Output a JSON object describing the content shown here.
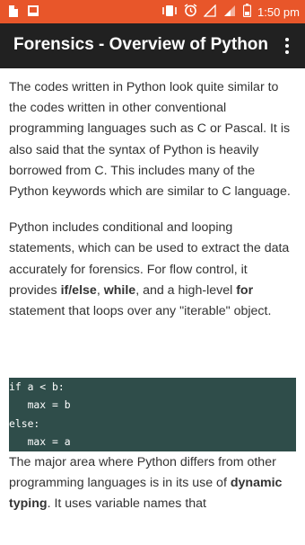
{
  "status_bar": {
    "time": "1:50 pm",
    "left_icons": [
      "file-icon",
      "image-icon"
    ],
    "right_icons": [
      "vibrate-icon",
      "alarm-icon",
      "no-signal-icon",
      "signal-icon",
      "battery-icon"
    ]
  },
  "app_bar": {
    "title": "Forensics - Overview of Python",
    "menu_icon": "more-vertical-icon"
  },
  "content": {
    "para1": "The codes written in Python look quite similar to the codes written in other conventional programming languages such as C or Pascal. It is also said that the syntax of Python is heavily borrowed from C. This includes many of the Python keywords which are similar to C language.",
    "para2": {
      "intro": "Python includes conditional and looping statements, which can be used to extract the data accurately for forensics. For flow control, it provides ",
      "kw_ifelse": "if/else",
      "sep1": ", ",
      "kw_while": "while",
      "mid": ", and a high-level ",
      "kw_for": "for",
      "end": " statement that loops over any \"iterable\" object."
    },
    "code_lines": [
      "if a < b:",
      "   max = b",
      "else:",
      "   max = a"
    ],
    "para3": {
      "intro": "The major area where Python differs from other programming languages is in its use of ",
      "kw_dynamic": "dynamic typing",
      "rest": ". It uses variable names that"
    }
  },
  "colors": {
    "status_bar": "#e8562a",
    "app_bar": "#212121",
    "code_bg": "#2f4d4a",
    "text": "#333333"
  }
}
